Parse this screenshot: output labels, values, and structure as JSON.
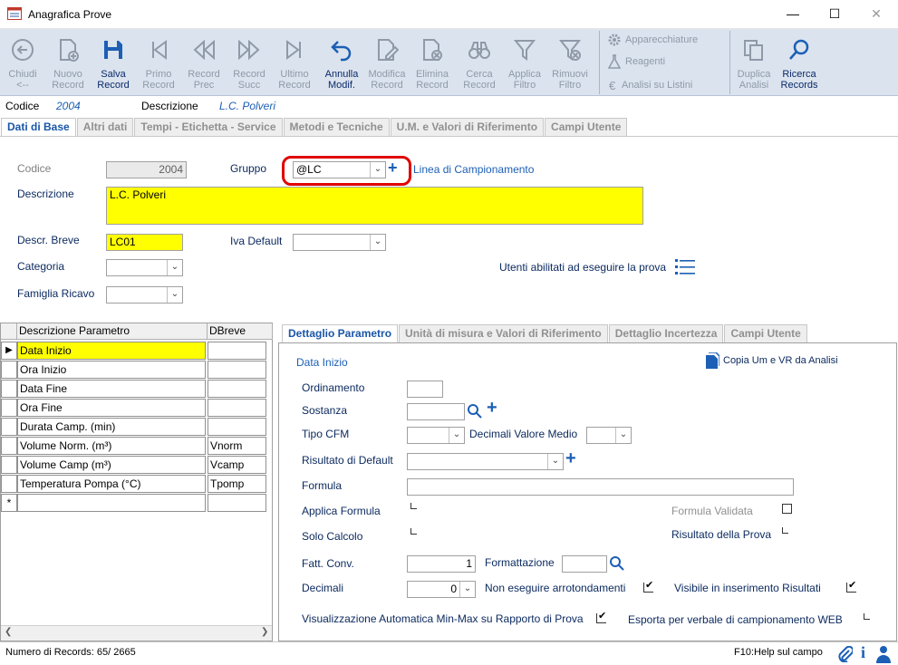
{
  "window": {
    "title": "Anagrafica Prove"
  },
  "toolbar": {
    "buttons": [
      {
        "label": "Chiudi\n<--",
        "icon": "close-back-icon"
      },
      {
        "label": "Nuovo\nRecord",
        "icon": "new-record-icon"
      },
      {
        "label": "Salva\nRecord",
        "icon": "save-icon"
      },
      {
        "label": "Primo\nRecord",
        "icon": "first-record-icon"
      },
      {
        "label": "Record\nPrec",
        "icon": "previous-record-icon"
      },
      {
        "label": "Record\nSucc",
        "icon": "next-record-icon"
      },
      {
        "label": "Ultimo\nRecord",
        "icon": "last-record-icon"
      },
      {
        "label": "Annulla\nModif.",
        "icon": "undo-icon"
      },
      {
        "label": "Modifica\nRecord",
        "icon": "edit-record-icon"
      },
      {
        "label": "Elimina\nRecord",
        "icon": "delete-record-icon"
      },
      {
        "label": "Cerca\nRecord",
        "icon": "binoculars-icon"
      },
      {
        "label": "Applica\nFiltro",
        "icon": "filter-icon"
      },
      {
        "label": "Rimuovi\nFiltro",
        "icon": "remove-filter-icon"
      }
    ],
    "links": [
      "Apparecchiature",
      "Reagenti",
      "Analisi su Listini"
    ],
    "right_buttons": [
      {
        "label": "Duplica\nAnalisi",
        "icon": "duplicate-icon"
      },
      {
        "label": "Ricerca\nRecords",
        "icon": "search-icon"
      }
    ]
  },
  "header": {
    "codice_label": "Codice",
    "codice_value": "2004",
    "descrizione_label": "Descrizione",
    "descrizione_value": "L.C. Polveri"
  },
  "main_tabs": [
    "Dati di Base",
    "Altri dati",
    "Tempi - Etichetta - Service",
    "Metodi e Tecniche",
    "U.M. e Valori di Riferimento",
    "Campi Utente"
  ],
  "form": {
    "codice_label": "Codice",
    "codice_value": "2004",
    "gruppo_label": "Gruppo",
    "gruppo_value": "@LC",
    "gruppo_link": "Linea di Campionamento",
    "descrizione_label": "Descrizione",
    "descrizione_value": "L.C. Polveri",
    "descr_breve_label": "Descr. Breve",
    "descr_breve_value": "LC01",
    "iva_label": "Iva Default",
    "iva_value": "",
    "categoria_label": "Categoria",
    "categoria_value": "",
    "famiglia_label": "Famiglia Ricavo",
    "famiglia_value": "",
    "utenti_label": "Utenti abilitati ad eseguire la prova"
  },
  "grid": {
    "columns": [
      "Descrizione Parametro",
      "DBreve"
    ],
    "rows": [
      {
        "desc": "Data Inizio",
        "breve": ""
      },
      {
        "desc": "Ora Inizio",
        "breve": ""
      },
      {
        "desc": "Data Fine",
        "breve": ""
      },
      {
        "desc": "Ora Fine",
        "breve": ""
      },
      {
        "desc": "Durata Camp. (min)",
        "breve": ""
      },
      {
        "desc": "Volume Norm. (m³)",
        "breve": "Vnorm"
      },
      {
        "desc": "Volume Camp  (m³)",
        "breve": "Vcamp"
      },
      {
        "desc": "Temperatura Pompa (°C)",
        "breve": "Tpomp"
      }
    ],
    "new_row_marker": "*"
  },
  "detail_tabs": [
    "Dettaglio Parametro",
    "Unità di misura e Valori di Riferimento",
    "Dettaglio Incertezza",
    "Campi Utente"
  ],
  "detail": {
    "title": "Data Inizio",
    "copy_link": "Copia Um e VR da Analisi",
    "ordinamento": "Ordinamento",
    "ordinamento_value": "",
    "sostanza": "Sostanza",
    "sostanza_value": "",
    "tipo_cfm": "Tipo CFM",
    "tipo_cfm_value": "",
    "decimali_medio": "Decimali Valore Medio",
    "decimali_medio_value": "",
    "risultato_default": "Risultato di Default",
    "risultato_default_value": "",
    "formula": "Formula",
    "formula_value": "",
    "applica_formula": "Applica Formula",
    "formula_validata": "Formula Validata",
    "solo_calcolo": "Solo Calcolo",
    "risultato_prova": "Risultato della Prova",
    "fatt_conv": "Fatt. Conv.",
    "fatt_conv_value": "1",
    "formattazione": "Formattazione",
    "formattazione_value": "",
    "decimali": "Decimali",
    "decimali_value": "0",
    "non_arrotondamenti": "Non eseguire arrotondamenti",
    "visibile_risultati": "Visibile in inserimento Risultati",
    "vis_auto": "Visualizzazione Automatica Min-Max su Rapporto di Prova",
    "esporta": "Esporta per verbale di campionamento WEB"
  },
  "status": {
    "records": "Numero di Records: 65/ 2665",
    "help": "F10:Help sul campo"
  },
  "colors": {
    "accent": "#1c5fb5",
    "highlight_yellow": "#ffff00",
    "toolbar_bg": "#dbe3ee",
    "annotation_red": "#e00000"
  }
}
